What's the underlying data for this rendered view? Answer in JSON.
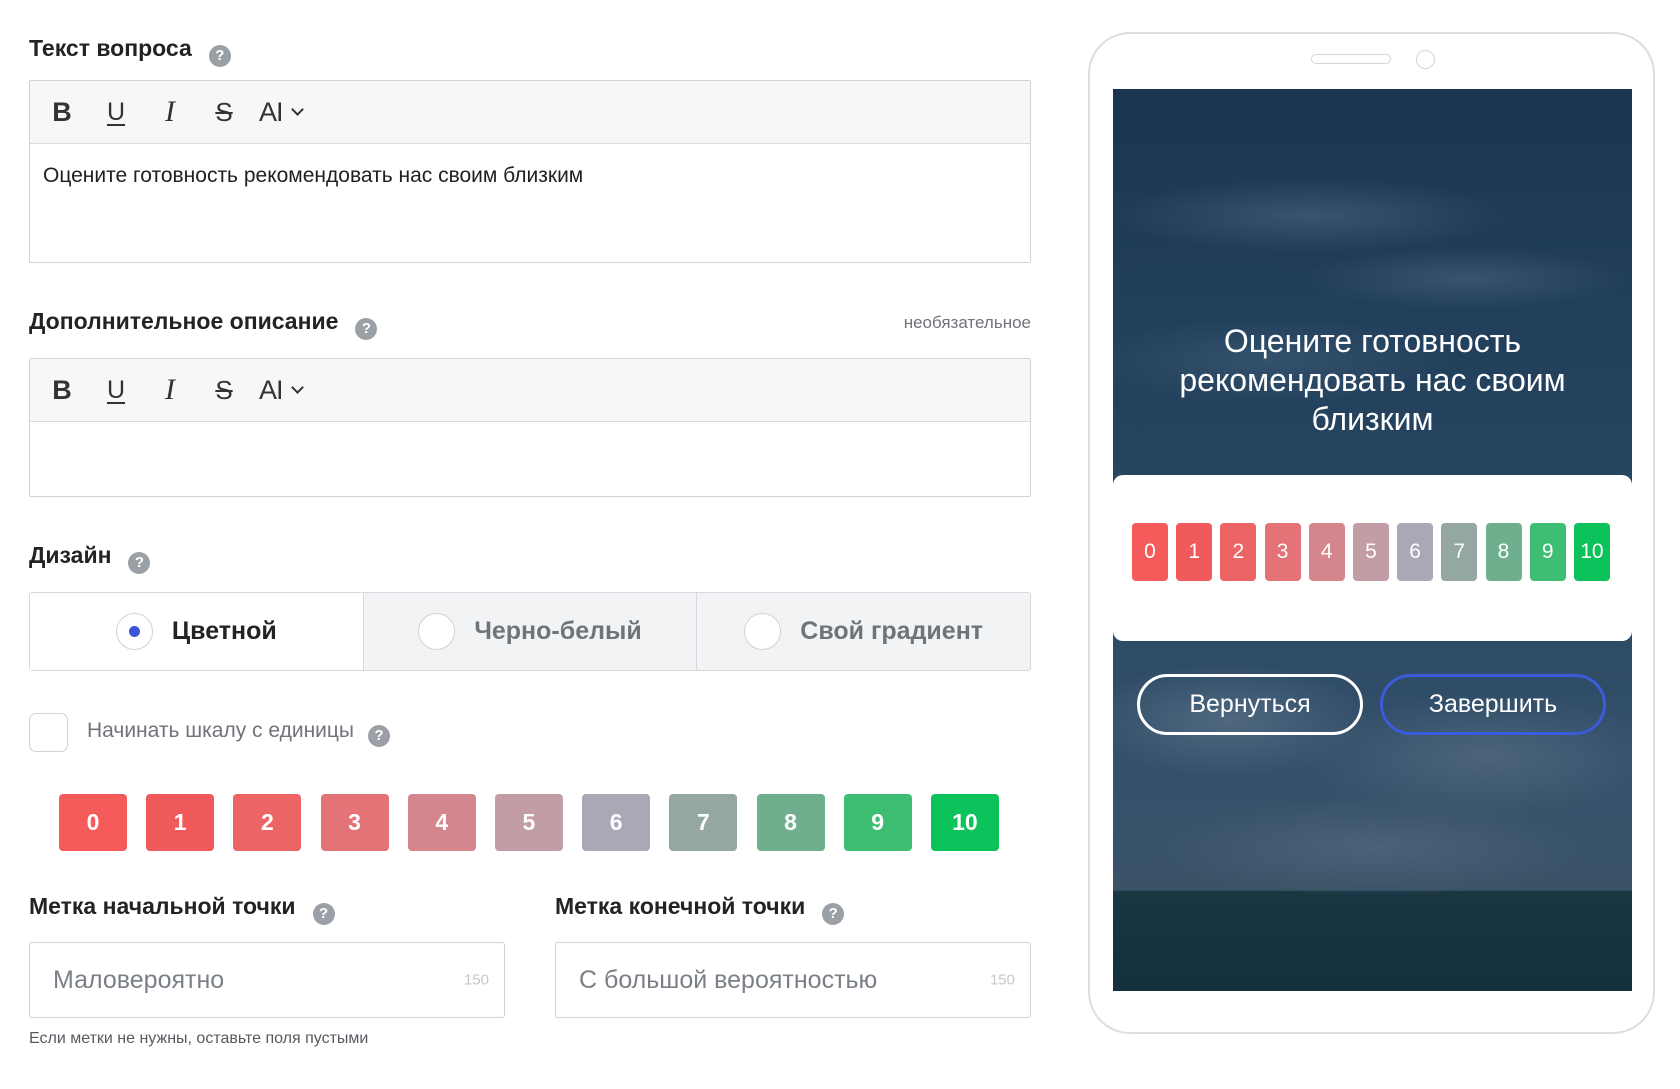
{
  "icons": {
    "help": "help-icon",
    "help_glyph": "?",
    "chevron": "chevron-down-icon"
  },
  "question": {
    "label": "Текст вопроса",
    "text": "Оцените готовность рекомендовать нас своим близким"
  },
  "toolbar": {
    "bold": "B",
    "underline": "U",
    "italic": "I",
    "strike": "S",
    "font_size": "AI"
  },
  "description": {
    "label": "Дополнительное описание",
    "optional": "необязательное",
    "text": ""
  },
  "design": {
    "label": "Дизайн",
    "options": [
      {
        "label": "Цветной",
        "selected": true
      },
      {
        "label": "Черно-белый",
        "selected": false
      },
      {
        "label": "Свой градиент",
        "selected": false
      }
    ]
  },
  "start_from_one": {
    "label": "Начинать шкалу с единицы",
    "checked": false
  },
  "scale": [
    {
      "label": "0",
      "color": "#F55B5B"
    },
    {
      "label": "1",
      "color": "#F05A5A"
    },
    {
      "label": "2",
      "color": "#EC6464"
    },
    {
      "label": "3",
      "color": "#E37376"
    },
    {
      "label": "4",
      "color": "#D5868C"
    },
    {
      "label": "5",
      "color": "#C29DA6"
    },
    {
      "label": "6",
      "color": "#A8A9B4"
    },
    {
      "label": "7",
      "color": "#95A7A3"
    },
    {
      "label": "8",
      "color": "#70AF8E"
    },
    {
      "label": "9",
      "color": "#3DBE72"
    },
    {
      "label": "10",
      "color": "#0BC35A"
    }
  ],
  "endpoints": {
    "start": {
      "label": "Метка начальной точки",
      "placeholder": "Маловероятно",
      "counter": "150"
    },
    "end": {
      "label": "Метка конечной точки",
      "placeholder": "С большой вероятностью",
      "counter": "150"
    },
    "hint": "Если метки не нужны, оставьте поля пустыми"
  },
  "preview": {
    "title": "Оцените готовность рекомендовать нас своим близким",
    "back_label": "Вернуться",
    "finish_label": "Завершить"
  },
  "colors": {
    "accent": "#3B55D9",
    "finish_border": "#3B5BDB",
    "help_icon": "#9AA0A6"
  }
}
